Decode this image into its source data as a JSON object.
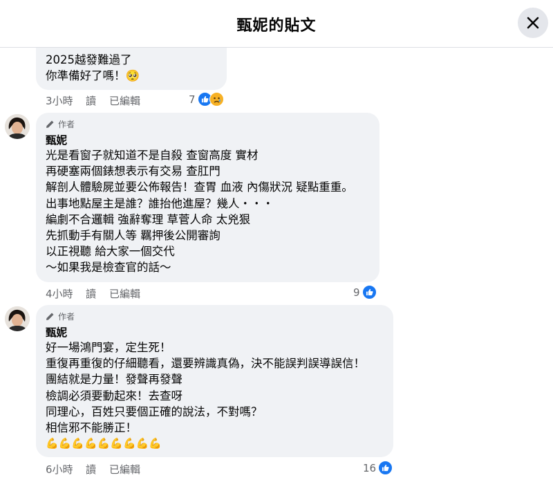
{
  "header": {
    "title": "甄妮的貼文"
  },
  "comments": [
    {
      "lines": [
        "2025越發難過了",
        "你準備好了嗎！🥺"
      ],
      "time": "3小時",
      "read_label": "讀",
      "edited_label": "已編輯",
      "reaction_count": "7"
    },
    {
      "author_badge": "作者",
      "name": "甄妮",
      "lines": [
        "光是看窗子就知道不是自殺 查窗高度 實材",
        "再硬塞兩個錶想表示有交易 查肛門",
        "解剖人體驗屍並要公佈報告！查胃 血液 內傷狀況 疑點重重。",
        "出事地點屋主是誰？誰抬他進屋？幾人・・・",
        "編劇不合邏輯 強辭奪理 草菅人命 太兇狠",
        "先抓動手有關人等 羈押後公開審詢",
        "以正視聽 給大家一個交代",
        "～如果我是檢查官的話～"
      ],
      "time": "4小時",
      "read_label": "讀",
      "edited_label": "已編輯",
      "reaction_count": "9"
    },
    {
      "author_badge": "作者",
      "name": "甄妮",
      "lines": [
        "好一場鴻門宴，定生死！",
        "重復再重復的仔細聽看，還要辨識真偽，決不能誤判誤導誤信！",
        "團結就是力量！發聲再發聲",
        "檢調必須要動起來！去查呀",
        "同理心，百姓只要個正確的說法，不對嗎？",
        "相信邪不能勝正！",
        "💪💪💪💪💪💪💪💪💪"
      ],
      "time": "6小時",
      "read_label": "讀",
      "edited_label": "已編輯",
      "reaction_count": "16"
    }
  ],
  "colors": {
    "like": "#1877f2",
    "bubble": "#f0f2f5",
    "meta": "#65676b"
  },
  "icons": {
    "close": "close-icon",
    "like": "like-icon",
    "sad": "sad-reaction-icon",
    "pencil": "pencil-icon"
  }
}
